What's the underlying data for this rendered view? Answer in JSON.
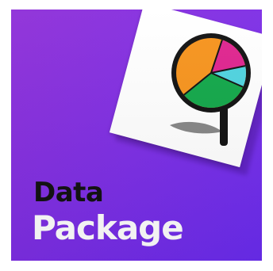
{
  "tile": {
    "title_line_1": "Data",
    "title_line_2": "Package"
  },
  "illustration": {
    "icon": "magnifier-pie-chart-icon",
    "slice_colors": [
      "#f7941d",
      "#e0248f",
      "#4fd4e0",
      "#12a84a"
    ]
  },
  "colors": {
    "background": "#7c2ee6",
    "card": "#ffffff",
    "title_dark": "#111111",
    "title_light": "#ffffff",
    "magnifier_ring": "#111111"
  }
}
